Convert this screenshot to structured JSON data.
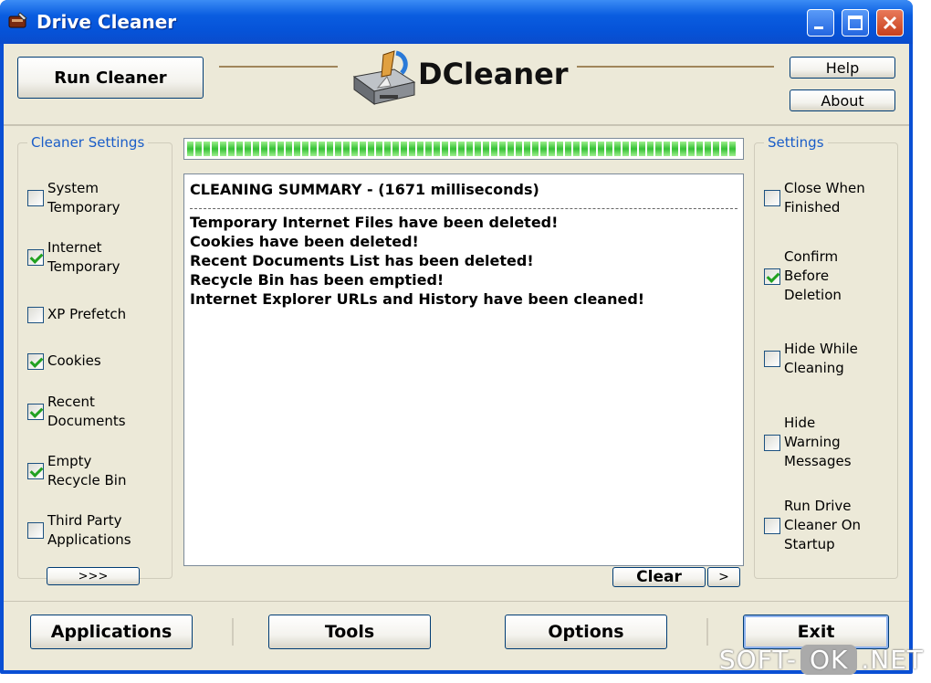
{
  "window": {
    "title": "Drive Cleaner"
  },
  "header": {
    "run_button": "Run Cleaner",
    "logo_text": "DCleaner",
    "help_button": "Help",
    "about_button": "About"
  },
  "cleaner_settings": {
    "title": "Cleaner Settings",
    "items": [
      {
        "label": "System\nTemporary",
        "checked": false
      },
      {
        "label": "Internet\nTemporary",
        "checked": true
      },
      {
        "label": "XP Prefetch",
        "checked": false
      },
      {
        "label": "Cookies",
        "checked": true
      },
      {
        "label": "Recent\nDocuments",
        "checked": true
      },
      {
        "label": "Empty\nRecycle Bin",
        "checked": true
      },
      {
        "label": "Third Party\nApplications",
        "checked": false
      }
    ],
    "more_button": ">>>"
  },
  "settings": {
    "title": "Settings",
    "items": [
      {
        "label": "Close When\nFinished",
        "checked": false
      },
      {
        "label": "Confirm\nBefore\nDeletion",
        "checked": true
      },
      {
        "label": "Hide While\nCleaning",
        "checked": false
      },
      {
        "label": "Hide\nWarning\nMessages",
        "checked": false
      },
      {
        "label": "Run Drive\nCleaner On\nStartup",
        "checked": false
      }
    ]
  },
  "progress": {
    "percent": 100
  },
  "log": {
    "heading": "CLEANING SUMMARY - (1671 milliseconds)",
    "lines": [
      "Temporary Internet Files have been deleted!",
      "Cookies have been deleted!",
      "Recent Documents List has been deleted!",
      "Recycle Bin has been emptied!",
      "Internet Explorer URLs and History have been cleaned!"
    ],
    "clear_button": "Clear",
    "next_button": ">"
  },
  "footer": {
    "applications": "Applications",
    "tools": "Tools",
    "options": "Options",
    "exit": "Exit"
  },
  "watermark": {
    "left": "SOFT-",
    "middle": "OK",
    "right": ".NET"
  }
}
